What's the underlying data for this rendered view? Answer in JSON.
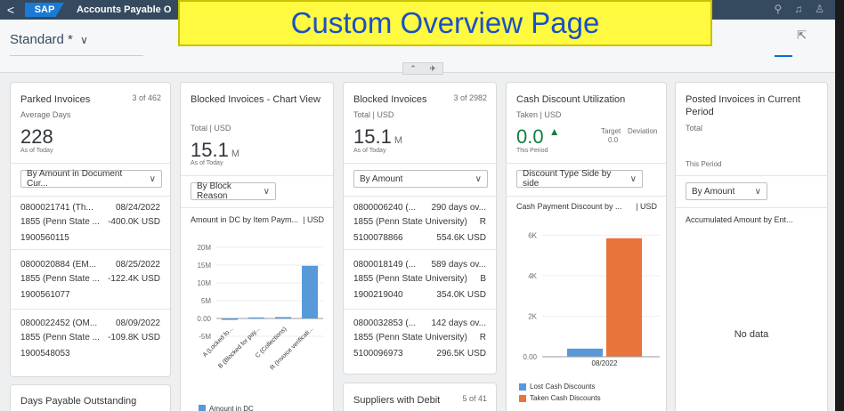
{
  "banner": {
    "text": "Custom Overview Page"
  },
  "shell": {
    "back": "<",
    "logo": "SAP",
    "title": "Accounts Payable O",
    "search": "⚲",
    "bell": "♫",
    "user": "♙"
  },
  "header": {
    "variant": "Standard *",
    "chevron": "∨",
    "share": "⇱",
    "collapse_up": "⌃",
    "pin": "✈"
  },
  "parked": {
    "title": "Parked Invoices",
    "count": "3 of 462",
    "subtitle": "Average Days",
    "kpi": "228",
    "kpi_sub": "As of Today",
    "dropdown": "By Amount in Document Cur...",
    "items": [
      {
        "id": "0800021741 (Th...",
        "date": "08/24/2022",
        "vendor": "1855 (Penn State ...",
        "amount": "-400.0K USD",
        "doc": "1900560115"
      },
      {
        "id": "0800020884 (EM...",
        "date": "08/25/2022",
        "vendor": "1855 (Penn State ...",
        "amount": "-122.4K USD",
        "doc": "1900561077"
      },
      {
        "id": "0800022452 (OM...",
        "date": "08/09/2022",
        "vendor": "1855 (Penn State ...",
        "amount": "-109.8K USD",
        "doc": "1900548053"
      }
    ]
  },
  "dpo": {
    "title": "Days Payable Outstanding"
  },
  "blocked_chart": {
    "title": "Blocked Invoices - Chart View",
    "subtitle": "Total | USD",
    "kpi": "15.1",
    "unit": "M",
    "kpi_sub": "As of Today",
    "dropdown": "By Block Reason",
    "chart_title": "Amount in DC by Item Paym...",
    "chart_unit": "| USD",
    "legend": "Amount in DC"
  },
  "blocked": {
    "title": "Blocked Invoices",
    "count": "3 of 2982",
    "subtitle": "Total | USD",
    "kpi": "15.1",
    "unit": "M",
    "kpi_sub": "As of Today",
    "dropdown": "By Amount",
    "items": [
      {
        "id": "0800006240 (...",
        "days": "290 days ov...",
        "vendor": "1855 (Penn State University)",
        "flag": "R",
        "doc": "5100078866",
        "amount": "554.6K USD"
      },
      {
        "id": "0800018149 (...",
        "days": "589 days ov...",
        "vendor": "1855 (Penn State University)",
        "flag": "B",
        "doc": "1900219040",
        "amount": "354.0K USD"
      },
      {
        "id": "0800032853 (...",
        "days": "142 days ov...",
        "vendor": "1855 (Penn State University)",
        "flag": "R",
        "doc": "5100096973",
        "amount": "296.5K USD"
      }
    ]
  },
  "suppliers": {
    "title": "Suppliers with Debit",
    "count": "5 of 41"
  },
  "cash": {
    "title": "Cash Discount Utilization",
    "subtitle": "Taken | USD",
    "kpi": "0.0",
    "arrow": "▲",
    "kpi_sub": "This Period",
    "target_label": "Target",
    "deviation_label": "Deviation",
    "target_value": "0.0",
    "dropdown": "Discount Type Side by side",
    "chart_title": "Cash Payment Discount by ...",
    "chart_unit": "| USD"
  },
  "posted": {
    "title": "Posted Invoices in Current Period",
    "subtitle": "Total",
    "period": "This Period",
    "dropdown": "By Amount",
    "chart_title": "Accumulated Amount by Ent...",
    "nodata": "No data"
  },
  "chart_data": [
    {
      "type": "bar",
      "categories": [
        "A (Locked fo...",
        "B (Blocked for pay...",
        "C (Collections)",
        "R (Invoice verificati..."
      ],
      "series": [
        {
          "name": "Amount in DC",
          "values": [
            -0.4,
            0.3,
            0.4,
            14.8
          ]
        }
      ],
      "yticks": [
        "20M",
        "15M",
        "10M",
        "5M",
        "0.00",
        "-5M"
      ],
      "ylim": [
        -5,
        20
      ],
      "color": "#5899da"
    },
    {
      "type": "bar",
      "categories": [
        "08/2022"
      ],
      "series": [
        {
          "name": "Lost Cash Discounts",
          "values": [
            400
          ],
          "color": "#5899da"
        },
        {
          "name": "Taken Cash Discounts",
          "values": [
            5850
          ],
          "color": "#e8743b"
        }
      ],
      "yticks": [
        "6K",
        "4K",
        "2K",
        "0.00"
      ],
      "ylim": [
        0,
        6500
      ]
    }
  ]
}
